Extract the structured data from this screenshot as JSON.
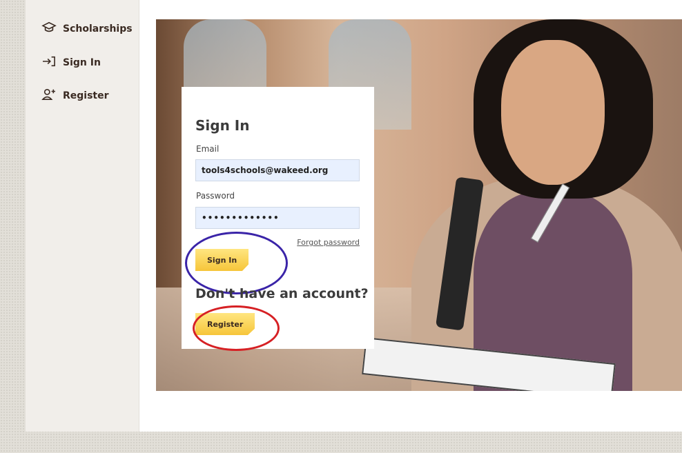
{
  "sidebar": {
    "items": [
      {
        "label": "Scholarships",
        "icon": "graduation-cap-icon"
      },
      {
        "label": "Sign In",
        "icon": "sign-in-icon"
      },
      {
        "label": "Register",
        "icon": "add-user-icon"
      }
    ]
  },
  "signin": {
    "title": "Sign In",
    "email_label": "Email",
    "email_value": "tools4schools@wakeed.org",
    "password_label": "Password",
    "password_value": "•••••••••••••",
    "forgot_link": "Forgot password",
    "signin_button": "Sign In",
    "no_account_text": "Don't have an account?",
    "register_button": "Register"
  },
  "colors": {
    "accent": "#f6c53a",
    "annotation_blue": "#3a24a8",
    "annotation_red": "#d62024",
    "input_bg": "#e8f0fe"
  }
}
